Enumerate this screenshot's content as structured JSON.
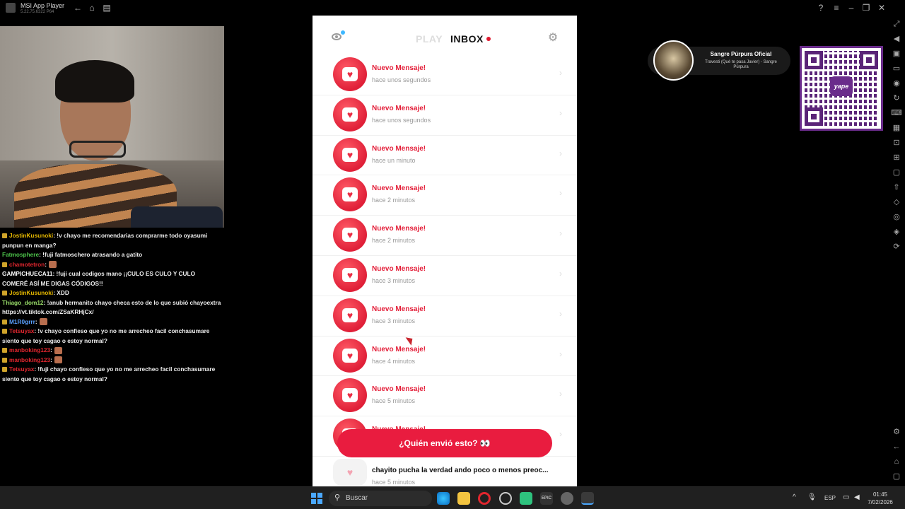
{
  "emulator": {
    "title": "MSI App Player",
    "version": "5.22.75.6322  P64"
  },
  "chat": [
    {
      "user": "JostinKusunoki",
      "color": "#e6b800",
      "badge": true,
      "text": ": !v chayo me recomendarias comprarme todo oyasumi punpun en manga?"
    },
    {
      "user": "Fatmosphere",
      "color": "#4cc24a",
      "badge": false,
      "text": ": !fuji fatmoschero atrasando a gatito"
    },
    {
      "user": "chamotetron",
      "color": "#e0262e",
      "badge": true,
      "text": ":"
    },
    {
      "user": "GAMPICHUECA11",
      "color": "#ffffff",
      "badge": false,
      "text": ": !fuji cual codigos mano ¡¡CULO ES CULO Y CULO COMERÉ ASÍ ME DIGAS CÓDIGOS!!"
    },
    {
      "user": "JostinKusunoki",
      "color": "#e6b800",
      "badge": true,
      "text": ": XDD"
    },
    {
      "user": "Thiago_dom12",
      "color": "#9be06a",
      "badge": false,
      "text": ": !anub hermanito chayo checa esto de lo que subió chayoextra https://vt.tiktok.com/ZSaKRHjCx/"
    },
    {
      "user": "M1R0grrr",
      "color": "#5aa0ff",
      "badge": true,
      "text": ":"
    },
    {
      "user": "Tetsuyax",
      "color": "#e0262e",
      "badge": true,
      "text": ": !v chayo confieso que yo no me arrecheo facil conchasumare siento que toy cagao o estoy normal?"
    },
    {
      "user": "manboking123",
      "color": "#e0262e",
      "badge": true,
      "text": ":"
    },
    {
      "user": "manboking123",
      "color": "#e0262e",
      "badge": true,
      "text": ":"
    },
    {
      "user": "Tetsuyax",
      "color": "#e0262e",
      "badge": true,
      "text": ": !fuji chayo confieso que yo no me arrecheo facil conchasumare siento que toy cagao o estoy normal?"
    }
  ],
  "app": {
    "tab_play": "PLAY",
    "tab_inbox": "INBOX",
    "messages": [
      {
        "title": "Nuevo Mensaje!",
        "time": "hace unos segundos"
      },
      {
        "title": "Nuevo Mensaje!",
        "time": "hace unos segundos"
      },
      {
        "title": "Nuevo Mensaje!",
        "time": "hace un minuto"
      },
      {
        "title": "Nuevo Mensaje!",
        "time": "hace 2 minutos"
      },
      {
        "title": "Nuevo Mensaje!",
        "time": "hace 2 minutos"
      },
      {
        "title": "Nuevo Mensaje!",
        "time": "hace 3 minutos"
      },
      {
        "title": "Nuevo Mensaje!",
        "time": "hace 3 minutos"
      },
      {
        "title": "Nuevo Mensaje!",
        "time": "hace 4 minutos"
      },
      {
        "title": "Nuevo Mensaje!",
        "time": "hace 5 minutos"
      },
      {
        "title": "Nuevo Mensaje!",
        "time": ""
      }
    ],
    "last_message": {
      "text": "chayito pucha la verdad ando poco o menos preoc...",
      "time": "hace 5 minutos"
    },
    "who_button": "¿Quién envió esto? 👀",
    "accent_color": "#e91c3f"
  },
  "now_playing": {
    "artist": "Sangre Púrpura Oficial",
    "title": "Travesti (Qué te pasa Javier) - Sangre Púrpura"
  },
  "qr": {
    "logo": "yape"
  },
  "taskbar": {
    "search_label": "Buscar",
    "language": "ESP",
    "time": "01:45",
    "date": "7/02/2026"
  }
}
